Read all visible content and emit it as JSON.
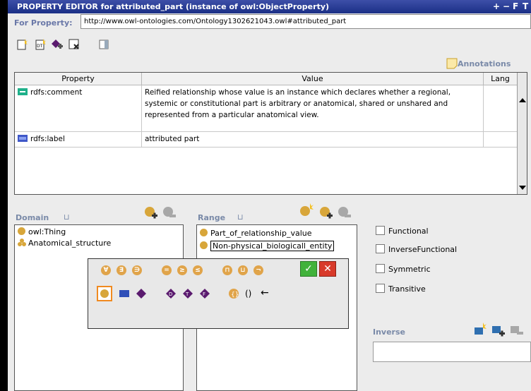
{
  "window": {
    "title": "PROPERTY EDITOR for attributed_part  (instance of owl:ObjectProperty)",
    "controls": [
      "+",
      "−",
      "F",
      "T"
    ]
  },
  "for_property": {
    "label": "For Property:",
    "value": "http://www.owl-ontologies.com/Ontology1302621043.owl#attributed_part"
  },
  "annotations_label": "Annotations",
  "table": {
    "headers": [
      "Property",
      "Value",
      "Lang"
    ],
    "rows": [
      {
        "property": "rdfs:comment",
        "value": "Reified relationship whose value is an instance which declares whether a regional, systemic or constitutional part is arbitrary or anatomical, shared or unshared and represented from a particular anatomical view.",
        "lang": ""
      },
      {
        "property": "rdfs:label",
        "value": "attributed part",
        "lang": ""
      }
    ]
  },
  "domain": {
    "label": "Domain",
    "items": [
      "owl:Thing",
      "Anatomical_structure"
    ]
  },
  "range": {
    "label": "Range",
    "items": [
      "Part_of_relationship_value",
      "Non-physical_biologicall_entity"
    ]
  },
  "characteristics": [
    "Functional",
    "InverseFunctional",
    "Symmetric",
    "Transitive"
  ],
  "inverse": {
    "label": "Inverse"
  },
  "expression_editor": {
    "row1_symbols": [
      "∀",
      "∃",
      "∋",
      "=",
      "≥",
      "≤",
      "⊓",
      "⊔",
      "¬"
    ],
    "row2_symbols": [
      "()",
      "←"
    ],
    "ok": "✓",
    "cancel": "✕"
  },
  "colors": {
    "title_bar": "#1b2f86",
    "class_dot": "#d8a63a",
    "section_label": "#7a8aa8"
  }
}
